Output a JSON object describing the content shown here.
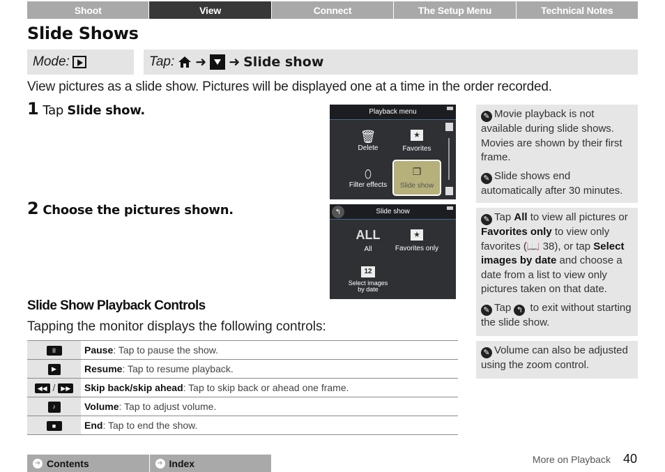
{
  "top_nav": [
    {
      "label": "Shoot",
      "active": false
    },
    {
      "label": "View",
      "active": true
    },
    {
      "label": "Connect",
      "active": false
    },
    {
      "label": "The Setup Menu",
      "active": false
    },
    {
      "label": "Technical Notes",
      "active": false
    }
  ],
  "title": "Slide Shows",
  "mode": {
    "label": "Mode:",
    "icon": "playback-icon"
  },
  "tap_path": {
    "label": "Tap:",
    "icons": [
      "home-icon",
      "down-icon"
    ],
    "arrow": "➜",
    "target": "Slide show"
  },
  "intro": "View pictures as a slide show. Pictures will be displayed one at a time in the order recorded.",
  "steps": [
    {
      "num": "1",
      "prefix": "Tap ",
      "bold": "Slide show."
    },
    {
      "num": "2",
      "text": "Choose the pictures shown."
    }
  ],
  "screen1": {
    "title": "Playback menu",
    "items": [
      "Delete",
      "Favorites",
      "Filter effects",
      "Slide show"
    ],
    "selected": "Slide show"
  },
  "screen2": {
    "title": "Slide show",
    "items": [
      "All",
      "Favorites only",
      "Select images by date"
    ],
    "all_glyph": "ALL",
    "date_glyph": "12"
  },
  "notes1": [
    "Movie playback is not available during slide shows. Movies are shown by their first frame.",
    "Slide shows end automatically after 30 minutes."
  ],
  "notes2": {
    "p1": {
      "t1": "Tap ",
      "b1": "All",
      "t2": " to view all pictures or ",
      "b2": "Favorites only",
      "t3": " to view only favorites (",
      "ref": "38",
      "t4": "), or tap ",
      "b3": "Select images by date",
      "t5": " and choose a date from a list to view only pictures taken on that date."
    },
    "p2": {
      "t1": "Tap ",
      "t2": " to exit without starting the slide show."
    }
  },
  "notes3": "Volume can also be adjusted using the zoom control.",
  "controls_heading": "Slide Show Playback Controls",
  "controls_sub": "Tapping the monitor displays the following controls:",
  "controls": [
    {
      "icon": "pause-icon",
      "glyph": "II",
      "name": "Pause",
      "desc": ": Tap to pause the show."
    },
    {
      "icon": "resume-icon",
      "glyph": "▶",
      "name": "Resume",
      "desc": ": Tap to resume playback."
    },
    {
      "icon": "skip-icon",
      "glyph": "◀◀ / ▶▶",
      "name": "Skip back/skip ahead",
      "desc": ": Tap to skip back or ahead one frame."
    },
    {
      "icon": "volume-icon",
      "glyph": "🔊",
      "name": "Volume",
      "desc": ": Tap to adjust volume."
    },
    {
      "icon": "end-icon",
      "glyph": "■",
      "name": "End",
      "desc": ": Tap to end the show."
    }
  ],
  "bottom_nav": [
    {
      "label": "Contents"
    },
    {
      "label": "Index"
    }
  ],
  "footer": {
    "section": "More on Playback",
    "page": "40"
  }
}
